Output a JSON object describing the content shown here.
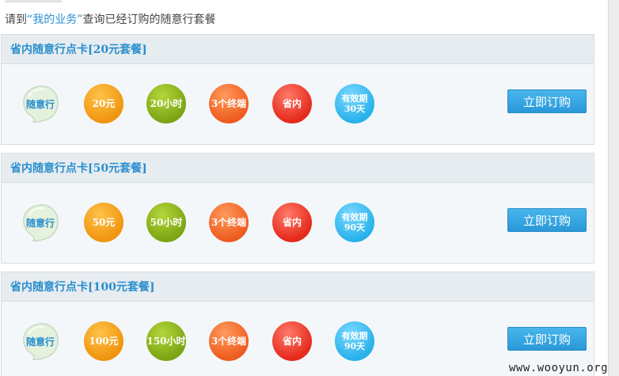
{
  "notice": {
    "prefix": "请到",
    "link": "“我的业务”",
    "suffix": "查询已经订购的随意行套餐"
  },
  "packages": [
    {
      "title": "省内随意行点卡[20元套餐]",
      "sticker": "随意行",
      "price": "20元",
      "hours": "20小时",
      "terminals": "3个终端",
      "scope": "省内",
      "validity_line1": "有效期",
      "validity_line2": "30天",
      "button": "立即订购"
    },
    {
      "title": "省内随意行点卡[50元套餐]",
      "sticker": "随意行",
      "price": "50元",
      "hours": "50小时",
      "terminals": "3个终端",
      "scope": "省内",
      "validity_line1": "有效期",
      "validity_line2": "90天",
      "button": "立即订购"
    },
    {
      "title": "省内随意行点卡[100元套餐]",
      "sticker": "随意行",
      "price": "100元",
      "hours": "150小时",
      "terminals": "3个终端",
      "scope": "省内",
      "validity_line1": "有效期",
      "validity_line2": "90天",
      "button": "立即订购"
    }
  ],
  "colors": {
    "title_blue": "#2a8fcf",
    "price_orange": "#f0950f",
    "hours_green": "#7ba514",
    "terminals_coral": "#ee5c1f",
    "scope_red": "#e52a1c",
    "validity_blue": "#29b2ea",
    "button_blue": "#2a98d8"
  },
  "watermark": "www.wooyun.org"
}
